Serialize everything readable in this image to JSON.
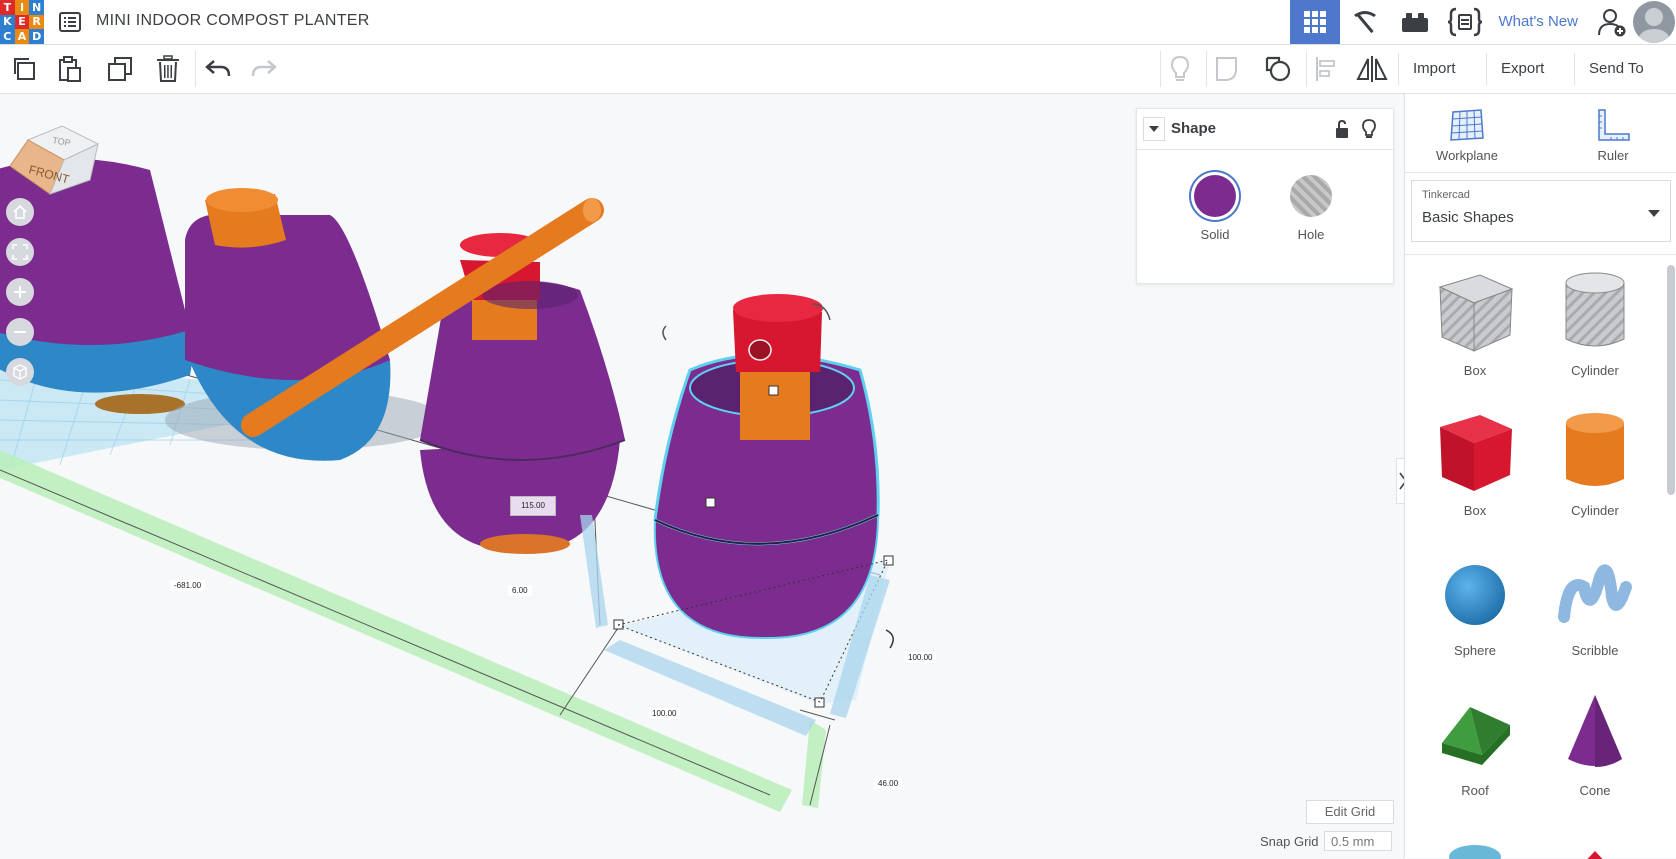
{
  "app": {
    "logo_letters": [
      "T",
      "I",
      "N",
      "K",
      "E",
      "R",
      "C",
      "A",
      "D"
    ],
    "project_title": "MINI INDOOR COMPOST PLANTER",
    "whats_new": "What's New"
  },
  "toolbar": {
    "import_label": "Import",
    "export_label": "Export",
    "send_to_label": "Send To"
  },
  "viewcube": {
    "top_label": "TOP",
    "front_label": "FRONT"
  },
  "dimensions": {
    "height": "115.00",
    "position_x": "-681.00",
    "elevation": "6.00",
    "length": "100.00",
    "width": "100.00",
    "position_y": "46.00"
  },
  "shape_panel": {
    "title": "Shape",
    "solid_label": "Solid",
    "hole_label": "Hole",
    "solid_color": "#7b2c8e"
  },
  "grid": {
    "edit_grid_label": "Edit Grid",
    "snap_grid_label": "Snap Grid",
    "snap_grid_value": "0.5 mm"
  },
  "sidebar": {
    "workplane_label": "Workplane",
    "ruler_label": "Ruler",
    "library_source": "Tinkercad",
    "library_name": "Basic Shapes",
    "shapes": [
      {
        "label": "Box"
      },
      {
        "label": "Cylinder"
      },
      {
        "label": "Box"
      },
      {
        "label": "Cylinder"
      },
      {
        "label": "Sphere"
      },
      {
        "label": "Scribble"
      },
      {
        "label": "Roof"
      },
      {
        "label": "Cone"
      }
    ]
  },
  "colors": {
    "accent": "#4d78cc",
    "purple": "#7b2c8e",
    "orange": "#e57a1e",
    "red": "#d7172f",
    "blue": "#2e88c7",
    "green": "#3aa63a"
  }
}
